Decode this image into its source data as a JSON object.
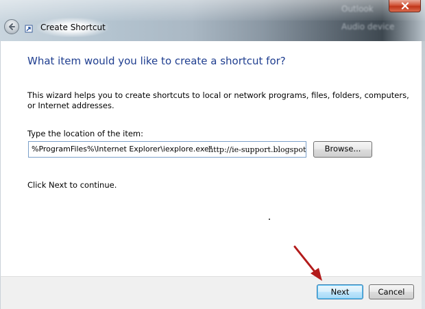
{
  "window": {
    "title": "Create Shortcut",
    "background_blurred_text": [
      "Outlook",
      "Audio device"
    ]
  },
  "wizard": {
    "heading": "What item would you like to create a shortcut for?",
    "description": "This wizard helps you to create shortcuts to local or network programs, files, folders, computers, or Internet addresses.",
    "location_label": "Type the location of the item:",
    "location_value": "%ProgramFiles%\\Internet Explorer\\iexplore.exe\"",
    "location_value_extra": "http://ie-support.blogspot.",
    "browse_label": "Browse...",
    "continue_text": "Click Next to continue."
  },
  "footer": {
    "next_label": "Next",
    "cancel_label": "Cancel"
  },
  "icons": {
    "back": "back-arrow-icon",
    "app": "shortcut-icon",
    "close": "close-icon",
    "annotation": "red-arrow-annotation"
  },
  "colors": {
    "heading": "#1e3d8f",
    "close_button": "#c0361a",
    "annotation_arrow": "#b31b1b",
    "next_button_border": "#3c7fb1"
  }
}
